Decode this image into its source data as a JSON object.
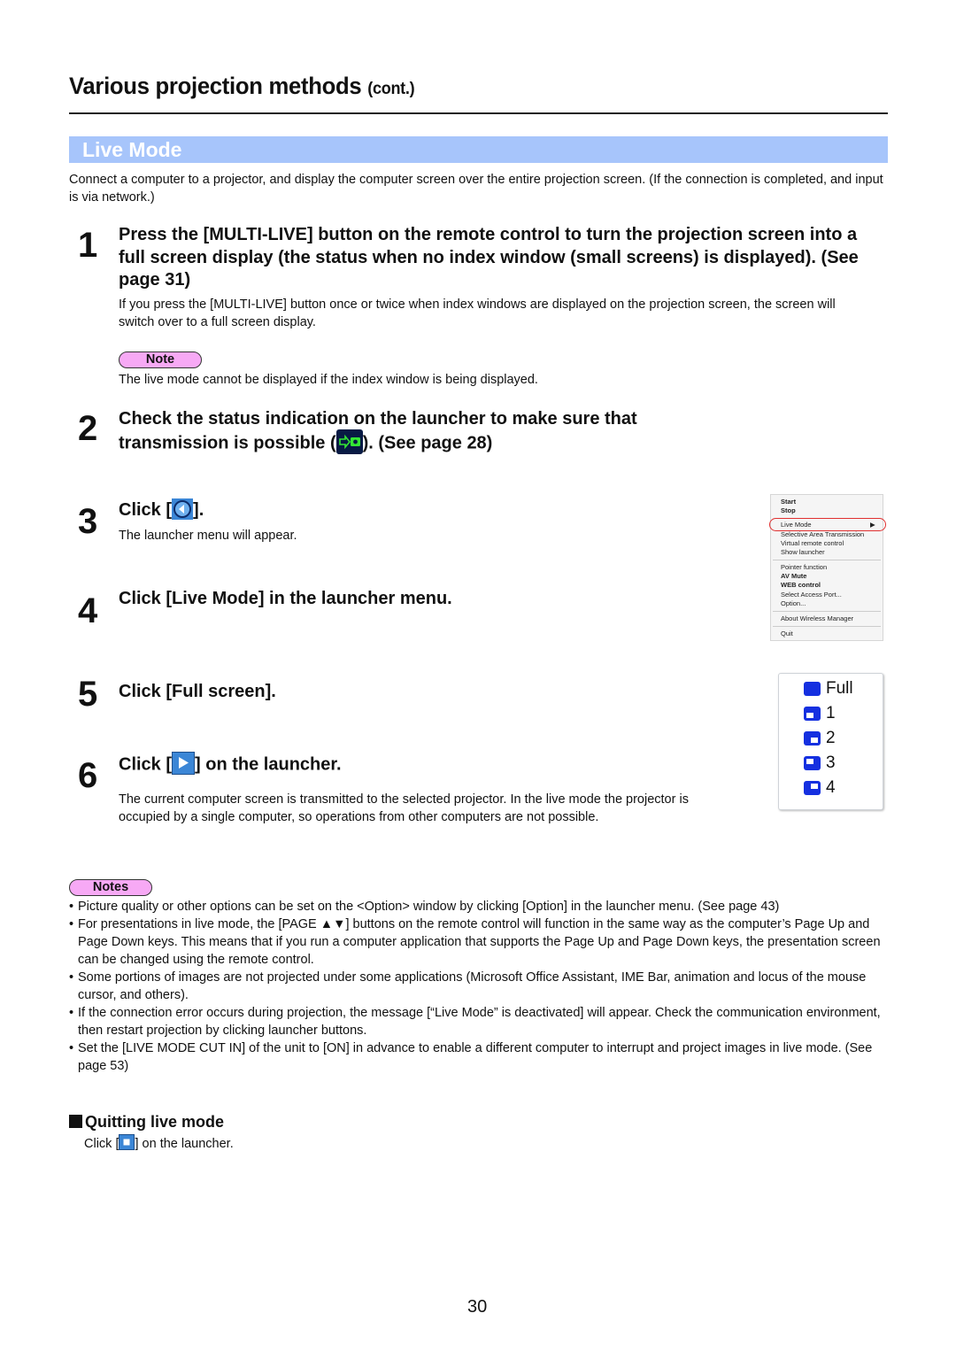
{
  "header": {
    "title": "Various projection methods",
    "title_suffix": "(cont.)"
  },
  "section": {
    "title": "Live Mode",
    "intro": "Connect a computer to a projector, and display the computer screen over the entire projection screen. (If the connection is completed, and input is via network.)"
  },
  "steps": [
    {
      "number": "1",
      "heading": "Press the [MULTI-LIVE] button on the remote control to turn the projection screen into a full screen display (the status when no index window (small screens) is displayed). (See page 31)",
      "body": "If you press the [MULTI-LIVE] button once or twice when index windows are displayed on the projection screen, the screen will switch over to a full screen display.",
      "note_label": "Note",
      "note": "The live mode cannot be displayed if the index window is being displayed."
    },
    {
      "number": "2",
      "heading_before": "Check the status indication on the launcher to make sure that transmission is possible (",
      "heading_after": "). (See page 28)",
      "icon": "transmission-possible-icon"
    },
    {
      "number": "3",
      "heading_before": "Click [",
      "heading_after": "].",
      "icon": "launcher-menu-icon",
      "body": "The launcher menu will appear."
    },
    {
      "number": "4",
      "heading": "Click [Live Mode] in the launcher menu."
    },
    {
      "number": "5",
      "heading": "Click [Full screen]."
    },
    {
      "number": "6",
      "heading_before": "Click [",
      "heading_after": "] on the launcher.",
      "icon": "play-icon",
      "body": "The current computer screen is transmitted to the selected projector. In the live mode the projector is occupied by a single computer, so operations from other computers are not possible."
    }
  ],
  "launcher_menu": {
    "items": [
      {
        "label": "Start",
        "bold": true
      },
      {
        "label": "Stop",
        "bold": true
      },
      {
        "label": "Live Mode",
        "submenu": true,
        "highlighted": true
      },
      {
        "label": "Selective Area Transmission"
      },
      {
        "label": "Virtual remote control"
      },
      {
        "label": "Show launcher"
      },
      {
        "label": "Pointer function"
      },
      {
        "label": "AV Mute",
        "bold": true
      },
      {
        "label": "WEB control",
        "bold": true
      },
      {
        "label": "Select Access Port..."
      },
      {
        "label": "Option..."
      },
      {
        "label": "About Wireless Manager"
      },
      {
        "label": "Quit"
      }
    ],
    "submenu_arrow": "▶"
  },
  "live_mode_submenu": {
    "items": [
      "Full",
      "1",
      "2",
      "3",
      "4"
    ]
  },
  "notes": {
    "label": "Notes",
    "bullet": "•",
    "items": [
      "Picture quality or other options can be set on the <Option> window by clicking [Option] in the launcher menu. (See page 43)",
      "For presentations in live mode, the [PAGE ▲▼] buttons on the remote control will function in the same way as the computer’s Page Up and Page Down keys. This means that if you run a computer application that supports the Page Up and Page Down keys, the presentation screen can be changed using the remote control.",
      "Some portions of images are not projected under some applications (Microsoft Office Assistant, IME Bar, animation and locus of the mouse cursor, and others).",
      "If the connection error occurs during projection, the message [“Live Mode” is deactivated] will appear. Check the communication environment, then restart projection by clicking launcher buttons.",
      "Set the [LIVE MODE CUT IN] of the unit to [ON] in advance to enable a different computer to interrupt and project images in live mode. (See page 53)"
    ]
  },
  "quitting": {
    "heading": "Quitting live mode",
    "body_before": "Click [",
    "body_after": "] on the launcher.",
    "icon": "stop-icon"
  },
  "footer": {
    "page_number": "30"
  },
  "colors": {
    "section_bar": "#a7c5fb",
    "note_pill": "#f7a9f5",
    "launcher_blue": "#3b86d6",
    "status_green": "#34e634",
    "highlight_red": "#e03030"
  }
}
